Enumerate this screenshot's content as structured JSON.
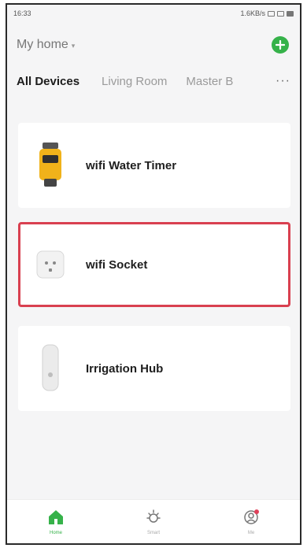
{
  "status_bar": {
    "time": "16:33",
    "network": "1.6KB/s"
  },
  "header": {
    "home_label": "My home",
    "caret": "▾",
    "add_icon": "plus-icon"
  },
  "tabs": [
    {
      "label": "All Devices",
      "active": true
    },
    {
      "label": "Living Room",
      "active": false
    },
    {
      "label": "Master B",
      "active": false
    }
  ],
  "tabs_more": "···",
  "devices": [
    {
      "name": "wifi Water Timer",
      "icon": "water-timer-icon",
      "highlighted": false
    },
    {
      "name": "wifi Socket",
      "icon": "socket-icon",
      "highlighted": true
    },
    {
      "name": "Irrigation Hub",
      "icon": "hub-icon",
      "highlighted": false
    }
  ],
  "bottom_nav": [
    {
      "label": "Home",
      "icon": "home-icon",
      "active": true
    },
    {
      "label": "Smart",
      "icon": "sun-icon",
      "active": false
    },
    {
      "label": "Me",
      "icon": "profile-icon",
      "active": false
    }
  ],
  "colors": {
    "accent": "#36b24a",
    "highlight": "#d94050",
    "background": "#f5f5f6"
  }
}
